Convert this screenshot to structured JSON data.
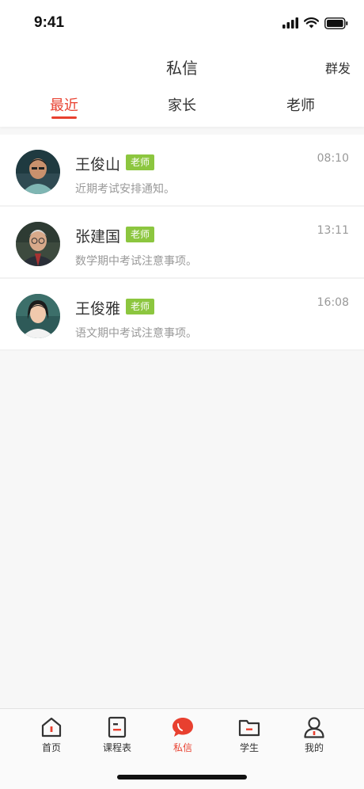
{
  "status_bar": {
    "time": "9:41"
  },
  "header": {
    "title": "私信",
    "action": "群发"
  },
  "tabs": [
    {
      "label": "最近",
      "active": true
    },
    {
      "label": "家长",
      "active": false
    },
    {
      "label": "老师",
      "active": false
    }
  ],
  "messages": [
    {
      "name": "王俊山",
      "badge": "老师",
      "time": "08:10",
      "preview": "近期考试安排通知。"
    },
    {
      "name": "张建国",
      "badge": "老师",
      "time": "13:11",
      "preview": "数学期中考试注意事项。"
    },
    {
      "name": "王俊雅",
      "badge": "老师",
      "time": "16:08",
      "preview": "语文期中考试注意事项。"
    }
  ],
  "tabbar": [
    {
      "label": "首页",
      "icon": "home-icon",
      "active": false
    },
    {
      "label": "课程表",
      "icon": "schedule-icon",
      "active": false
    },
    {
      "label": "私信",
      "icon": "chat-bubble-icon",
      "active": true
    },
    {
      "label": "学生",
      "icon": "folder-icon",
      "active": false
    },
    {
      "label": "我的",
      "icon": "person-icon",
      "active": false
    }
  ],
  "colors": {
    "accent": "#e8402f",
    "badge": "#8cc63f"
  }
}
